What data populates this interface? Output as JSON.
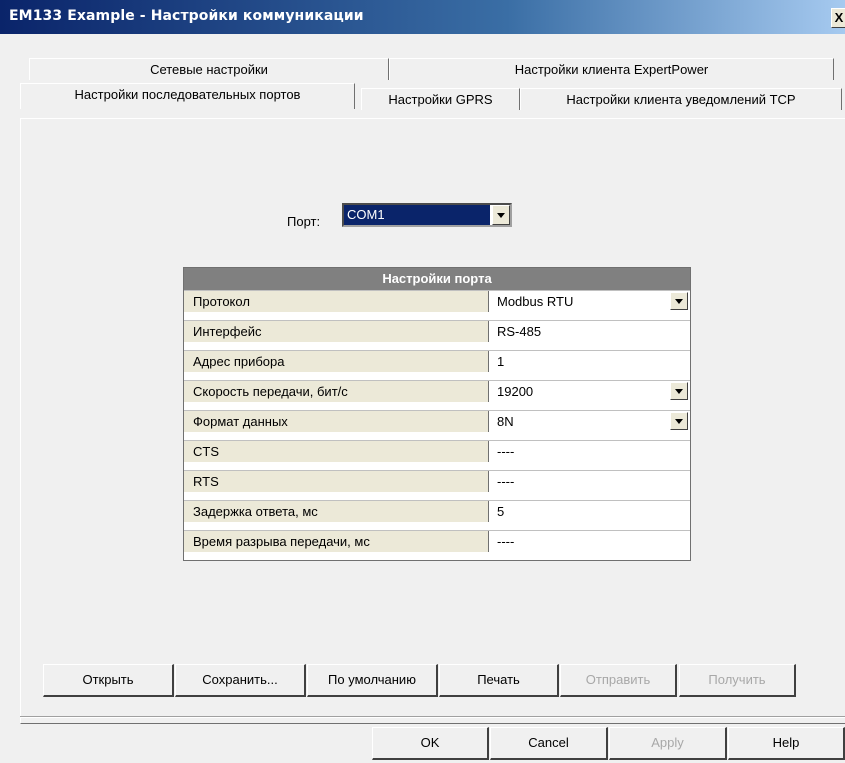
{
  "window": {
    "title": "EM133 Example - Настройки коммуникации",
    "close_glyph": "X"
  },
  "tabs": {
    "row1": [
      {
        "label": "Сетевые настройки"
      },
      {
        "label": "Настройки клиента ExpertPower"
      }
    ],
    "row2": [
      {
        "label": "Настройки последовательных портов",
        "active": true
      },
      {
        "label": "Настройки GPRS"
      },
      {
        "label": "Настройки клиента уведомлений TCP"
      }
    ]
  },
  "port": {
    "label": "Порт:",
    "value": "COM1"
  },
  "grid": {
    "header": "Настройки порта",
    "rows": [
      {
        "name": "Протокол",
        "value": "Modbus RTU",
        "dropdown": true
      },
      {
        "name": "Интерфейс",
        "value": "RS-485",
        "dropdown": false
      },
      {
        "name": "Адрес прибора",
        "value": "1",
        "dropdown": false
      },
      {
        "name": "Скорость передачи, бит/с",
        "value": "19200",
        "dropdown": true
      },
      {
        "name": "Формат данных",
        "value": "8N",
        "dropdown": true
      },
      {
        "name": "CTS",
        "value": "----",
        "dropdown": false
      },
      {
        "name": "RTS",
        "value": "----",
        "dropdown": false
      },
      {
        "name": "Задержка ответа, мс",
        "value": "5",
        "dropdown": false
      },
      {
        "name": "Время разрыва передачи, мс",
        "value": "----",
        "dropdown": false
      }
    ]
  },
  "buttons": {
    "open": "Открыть",
    "save": "Сохранить...",
    "default": "По умолчанию",
    "print": "Печать",
    "send": "Отправить",
    "receive": "Получить"
  },
  "dialog_buttons": {
    "ok": "OK",
    "cancel": "Cancel",
    "apply": "Apply",
    "help": "Help"
  },
  "colors": {
    "title_bar": "#0a246a",
    "selection": "#0a246a",
    "grid_header": "#808080"
  }
}
